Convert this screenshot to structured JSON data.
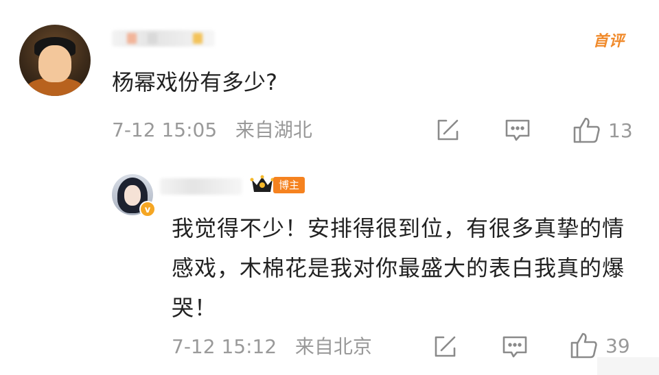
{
  "comment": {
    "first_comment_label": "首评",
    "text": "杨幂戏份有多少?",
    "timestamp": "7-12 15:05",
    "location": "来自湖北",
    "like_count": "13"
  },
  "reply": {
    "blogger_label": "博主",
    "verified_mark": "v",
    "text": "我觉得不少！安排得很到位，有很多真挚的情感戏，木棉花是我对你最盛大的表白我真的爆哭！",
    "timestamp": "7-12 15:12",
    "location": "来自北京",
    "like_count": "39"
  },
  "icons": [
    "share-icon",
    "comment-icon",
    "thumbs-up-icon",
    "crown-icon"
  ],
  "colors": {
    "accent_orange": "#f08a2b",
    "meta_gray": "#999999",
    "text_dark": "#222222"
  }
}
